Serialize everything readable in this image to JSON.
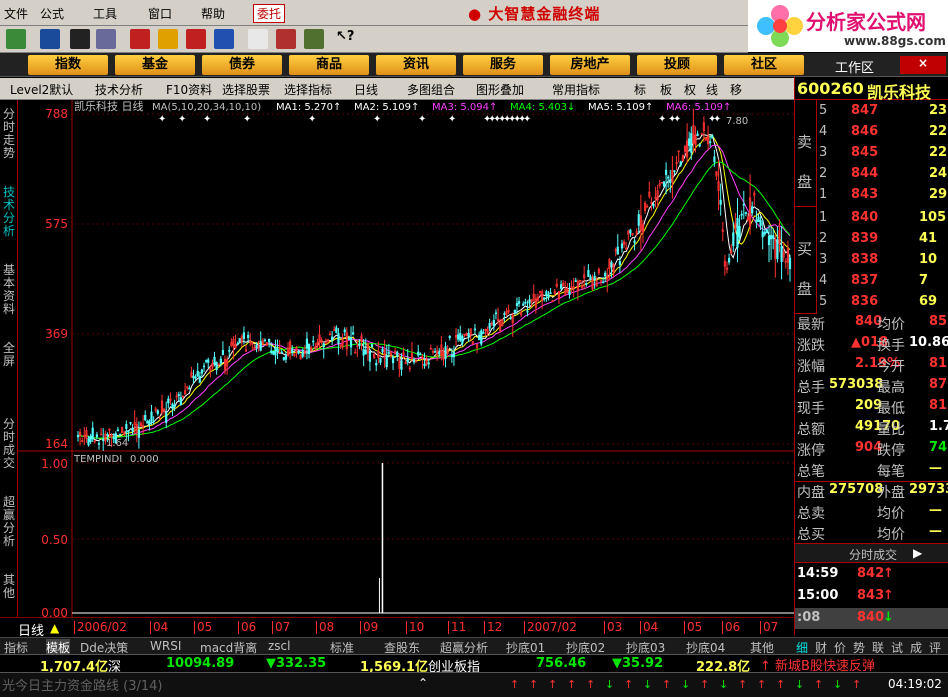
{
  "menu": {
    "items": [
      "文件",
      "公式",
      "工具",
      "窗口",
      "帮助"
    ],
    "weituo": "委托",
    "app_title": "大智慧金融终端"
  },
  "logo": {
    "text": "分析家公式网",
    "url": "www.88gs.com"
  },
  "nav": {
    "items": [
      "指数",
      "基金",
      "债券",
      "商品",
      "资讯",
      "服务",
      "房地产",
      "投顾",
      "社区"
    ],
    "workspace": "工作区"
  },
  "tabs": {
    "items": [
      "Level2默认",
      "技术分析",
      "F10资料",
      "选择股票",
      "选择指标",
      "日线",
      "多图组合",
      "图形叠加",
      "常用指标"
    ],
    "icons": [
      "标",
      "板",
      "权",
      "线",
      "移"
    ]
  },
  "sidebar": {
    "items": [
      "分时走势",
      "技术分析",
      "基本资料",
      "全屏",
      "分时成交",
      "超赢分析",
      "其他"
    ]
  },
  "stock": {
    "code": "600260",
    "name": "凯乐科技"
  },
  "chart_data": [
    {
      "type": "candlestick",
      "title": "凯乐科技 日线",
      "ma_label": "MA(5,10,20,34,10,10)",
      "ma_values": [
        {
          "name": "MA1",
          "value": "5.270↑",
          "color": "#ffffff"
        },
        {
          "name": "MA2",
          "value": "5.109↑",
          "color": "#ffffff"
        },
        {
          "name": "MA3",
          "value": "5.094↑",
          "color": "#ff40ff"
        },
        {
          "name": "MA4",
          "value": "5.403↓",
          "color": "#00ff00"
        },
        {
          "name": "MA5",
          "value": "5.109↑",
          "color": "#ffffff"
        },
        {
          "name": "MA6",
          "value": "5.109↑",
          "color": "#ff40ff"
        }
      ],
      "y_ticks": [
        "788",
        "575",
        "369",
        "164"
      ],
      "low_label": "1.64",
      "high_label": "7.80",
      "x_ticks": [
        "2006/02",
        "04",
        "05",
        "06",
        "07",
        "08",
        "09",
        "10",
        "11",
        "12",
        "2007/02",
        "03",
        "04",
        "05",
        "06",
        "07"
      ]
    },
    {
      "type": "line",
      "title": "TEMPINDI",
      "value": "0.000",
      "y_ticks": [
        "1.00",
        "0.50",
        "0.00"
      ],
      "ylim": [
        0,
        1
      ],
      "spike_position": 0.43
    }
  ],
  "period": {
    "label": "日线"
  },
  "formula_tabs": [
    "指标",
    "模板",
    "Dde决策",
    "WRSI",
    "macd背离",
    "zscl",
    "标准",
    "查股东",
    "超赢分析",
    "抄底01",
    "抄底02",
    "抄底03",
    "抄底04",
    "其他"
  ],
  "quote": {
    "sell": [
      {
        "n": "5",
        "p": "847",
        "v": "23"
      },
      {
        "n": "4",
        "p": "846",
        "v": "22"
      },
      {
        "n": "3",
        "p": "845",
        "v": "22"
      },
      {
        "n": "2",
        "p": "844",
        "v": "24"
      },
      {
        "n": "1",
        "p": "843",
        "v": "29"
      }
    ],
    "buy": [
      {
        "n": "1",
        "p": "840",
        "v": "105"
      },
      {
        "n": "2",
        "p": "839",
        "v": "41"
      },
      {
        "n": "3",
        "p": "838",
        "v": "10"
      },
      {
        "n": "4",
        "p": "837",
        "v": "7"
      },
      {
        "n": "5",
        "p": "836",
        "v": "69"
      }
    ],
    "sell_label": "卖盘",
    "buy_label": "买盘",
    "rows": [
      {
        "l": "最新",
        "v": "840",
        "l2": "均价",
        "v2": "85"
      },
      {
        "l": "涨跌",
        "v": "▲018",
        "l2": "换手",
        "v2": "10.86"
      },
      {
        "l": "涨幅",
        "v": "2.19%",
        "l2": "今开",
        "v2": "81"
      },
      {
        "l": "总手",
        "v": "573038",
        "l2": "最高",
        "v2": "87"
      },
      {
        "l": "现手",
        "v": "209",
        "l2": "最低",
        "v2": "81"
      },
      {
        "l": "总额",
        "v": "49170",
        "l2": "量比",
        "v2": "1.7"
      },
      {
        "l": "涨停",
        "v": "904",
        "l2": "跌停",
        "v2": "74"
      },
      {
        "l": "总笔",
        "v": "",
        "l2": "每笔",
        "v2": "—"
      },
      {
        "l": "内盘",
        "v": "275708",
        "l2": "外盘",
        "v2": "29733"
      },
      {
        "l": "总卖",
        "v": "",
        "l2": "均价",
        "v2": "—"
      },
      {
        "l": "总买",
        "v": "",
        "l2": "均价",
        "v2": "—"
      }
    ],
    "trades_title": "分时成交",
    "trades": [
      {
        "t": "14:59",
        "p": "842",
        "d": "↑"
      },
      {
        "t": "15:00",
        "p": "843",
        "d": "↑"
      },
      {
        "t": ":08",
        "p": "840",
        "d": "↓"
      }
    ],
    "rtabs": [
      "细",
      "财",
      "价",
      "势",
      "联",
      "试",
      "成",
      "评"
    ]
  },
  "index": {
    "sh_amount": "1,707.4亿",
    "sz": "深",
    "sz_value": "10094.89",
    "sz_change": "▼332.35",
    "sz_amount": "1,569.1亿",
    "cyb": "创业板指",
    "cyb_value": "756.46",
    "cyb_change": "▼35.92",
    "cyb_amount": "222.8亿",
    "news": "↑ 新城B股快速反弹"
  },
  "status": {
    "text": "光今日主力资金路线 (3/14)",
    "time": "04:19:02"
  }
}
